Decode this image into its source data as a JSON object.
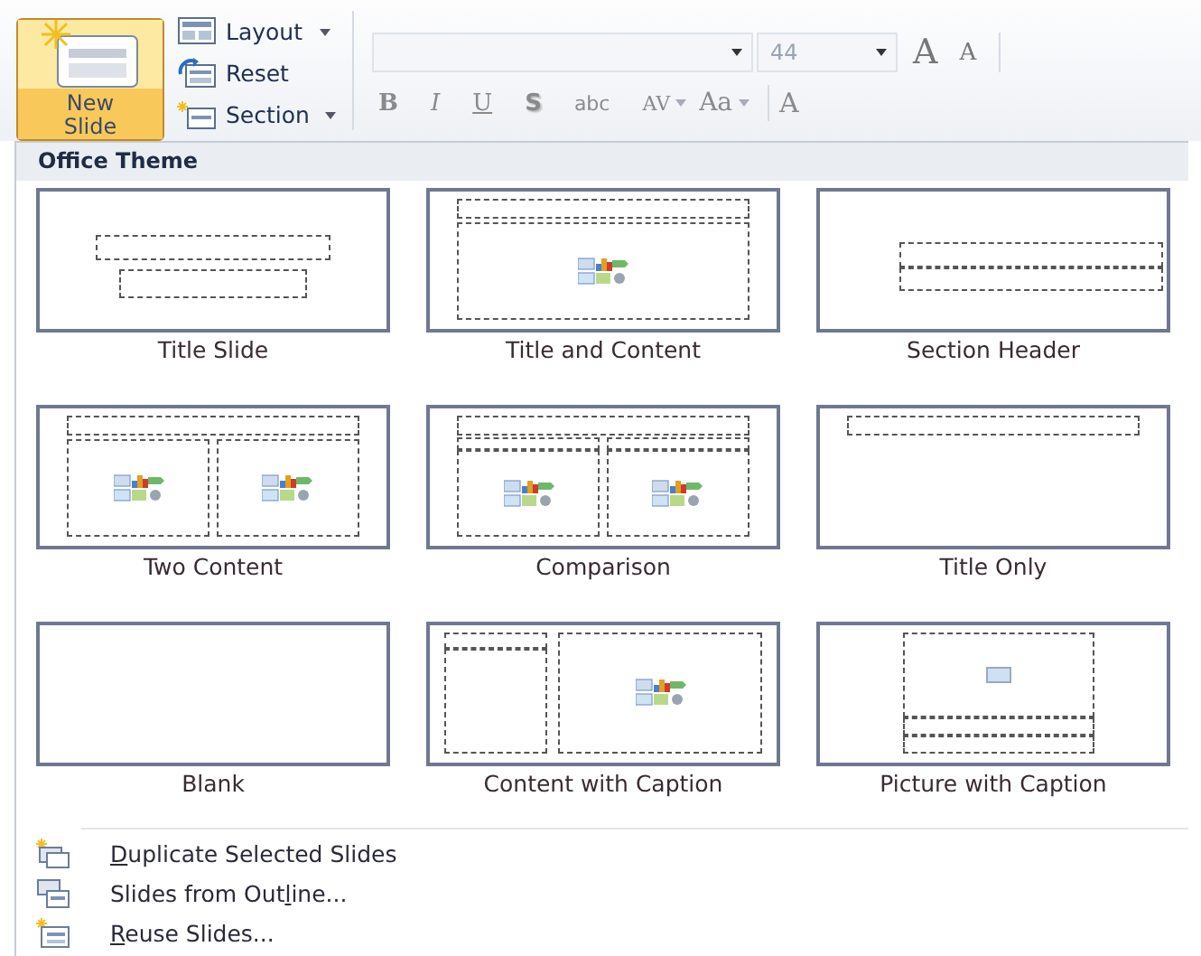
{
  "ribbon": {
    "new_slide": {
      "label": "New Slide",
      "open": true
    },
    "slide_commands": [
      {
        "kind": "layout",
        "label": "Layout",
        "dropdown": true
      },
      {
        "kind": "reset",
        "label": "Reset",
        "dropdown": false
      },
      {
        "kind": "section",
        "label": "Section",
        "dropdown": true
      }
    ],
    "font_size": {
      "value": "44"
    },
    "size_buttons": [
      {
        "kind": "grow",
        "label": "A"
      },
      {
        "kind": "shrink",
        "label": "A"
      }
    ],
    "format_buttons": [
      {
        "kind": "bold",
        "label": "B",
        "dropdown": false
      },
      {
        "kind": "italic",
        "label": "I",
        "dropdown": false
      },
      {
        "kind": "underline",
        "label": "U",
        "dropdown": false
      },
      {
        "kind": "shadow",
        "label": "S",
        "dropdown": false
      },
      {
        "kind": "strike",
        "label": "abc",
        "dropdown": false
      },
      {
        "kind": "spacing",
        "label": "AV",
        "dropdown": true
      },
      {
        "kind": "case",
        "label": "Aa",
        "dropdown": true
      }
    ],
    "cut_off_button": {
      "label": "A"
    }
  },
  "menu": {
    "section_title": "Office Theme",
    "layouts": [
      {
        "kind": "title",
        "label": "Title Slide"
      },
      {
        "kind": "title-content",
        "label": "Title and Content"
      },
      {
        "kind": "section",
        "label": "Section Header"
      },
      {
        "kind": "two-content",
        "label": "Two Content"
      },
      {
        "kind": "comparison",
        "label": "Comparison"
      },
      {
        "kind": "title-only",
        "label": "Title Only"
      },
      {
        "kind": "blank",
        "label": "Blank"
      },
      {
        "kind": "content-caption",
        "label": "Content with Caption"
      },
      {
        "kind": "picture-caption",
        "label": "Picture with Caption"
      }
    ],
    "commands": [
      {
        "kind": "duplicate",
        "key": "D",
        "after": "uplicate Selected Slides"
      },
      {
        "kind": "outline",
        "before": "Slides from Out",
        "key": "l",
        "after": "ine..."
      },
      {
        "kind": "reuse",
        "key": "R",
        "after": "euse Slides..."
      }
    ]
  }
}
